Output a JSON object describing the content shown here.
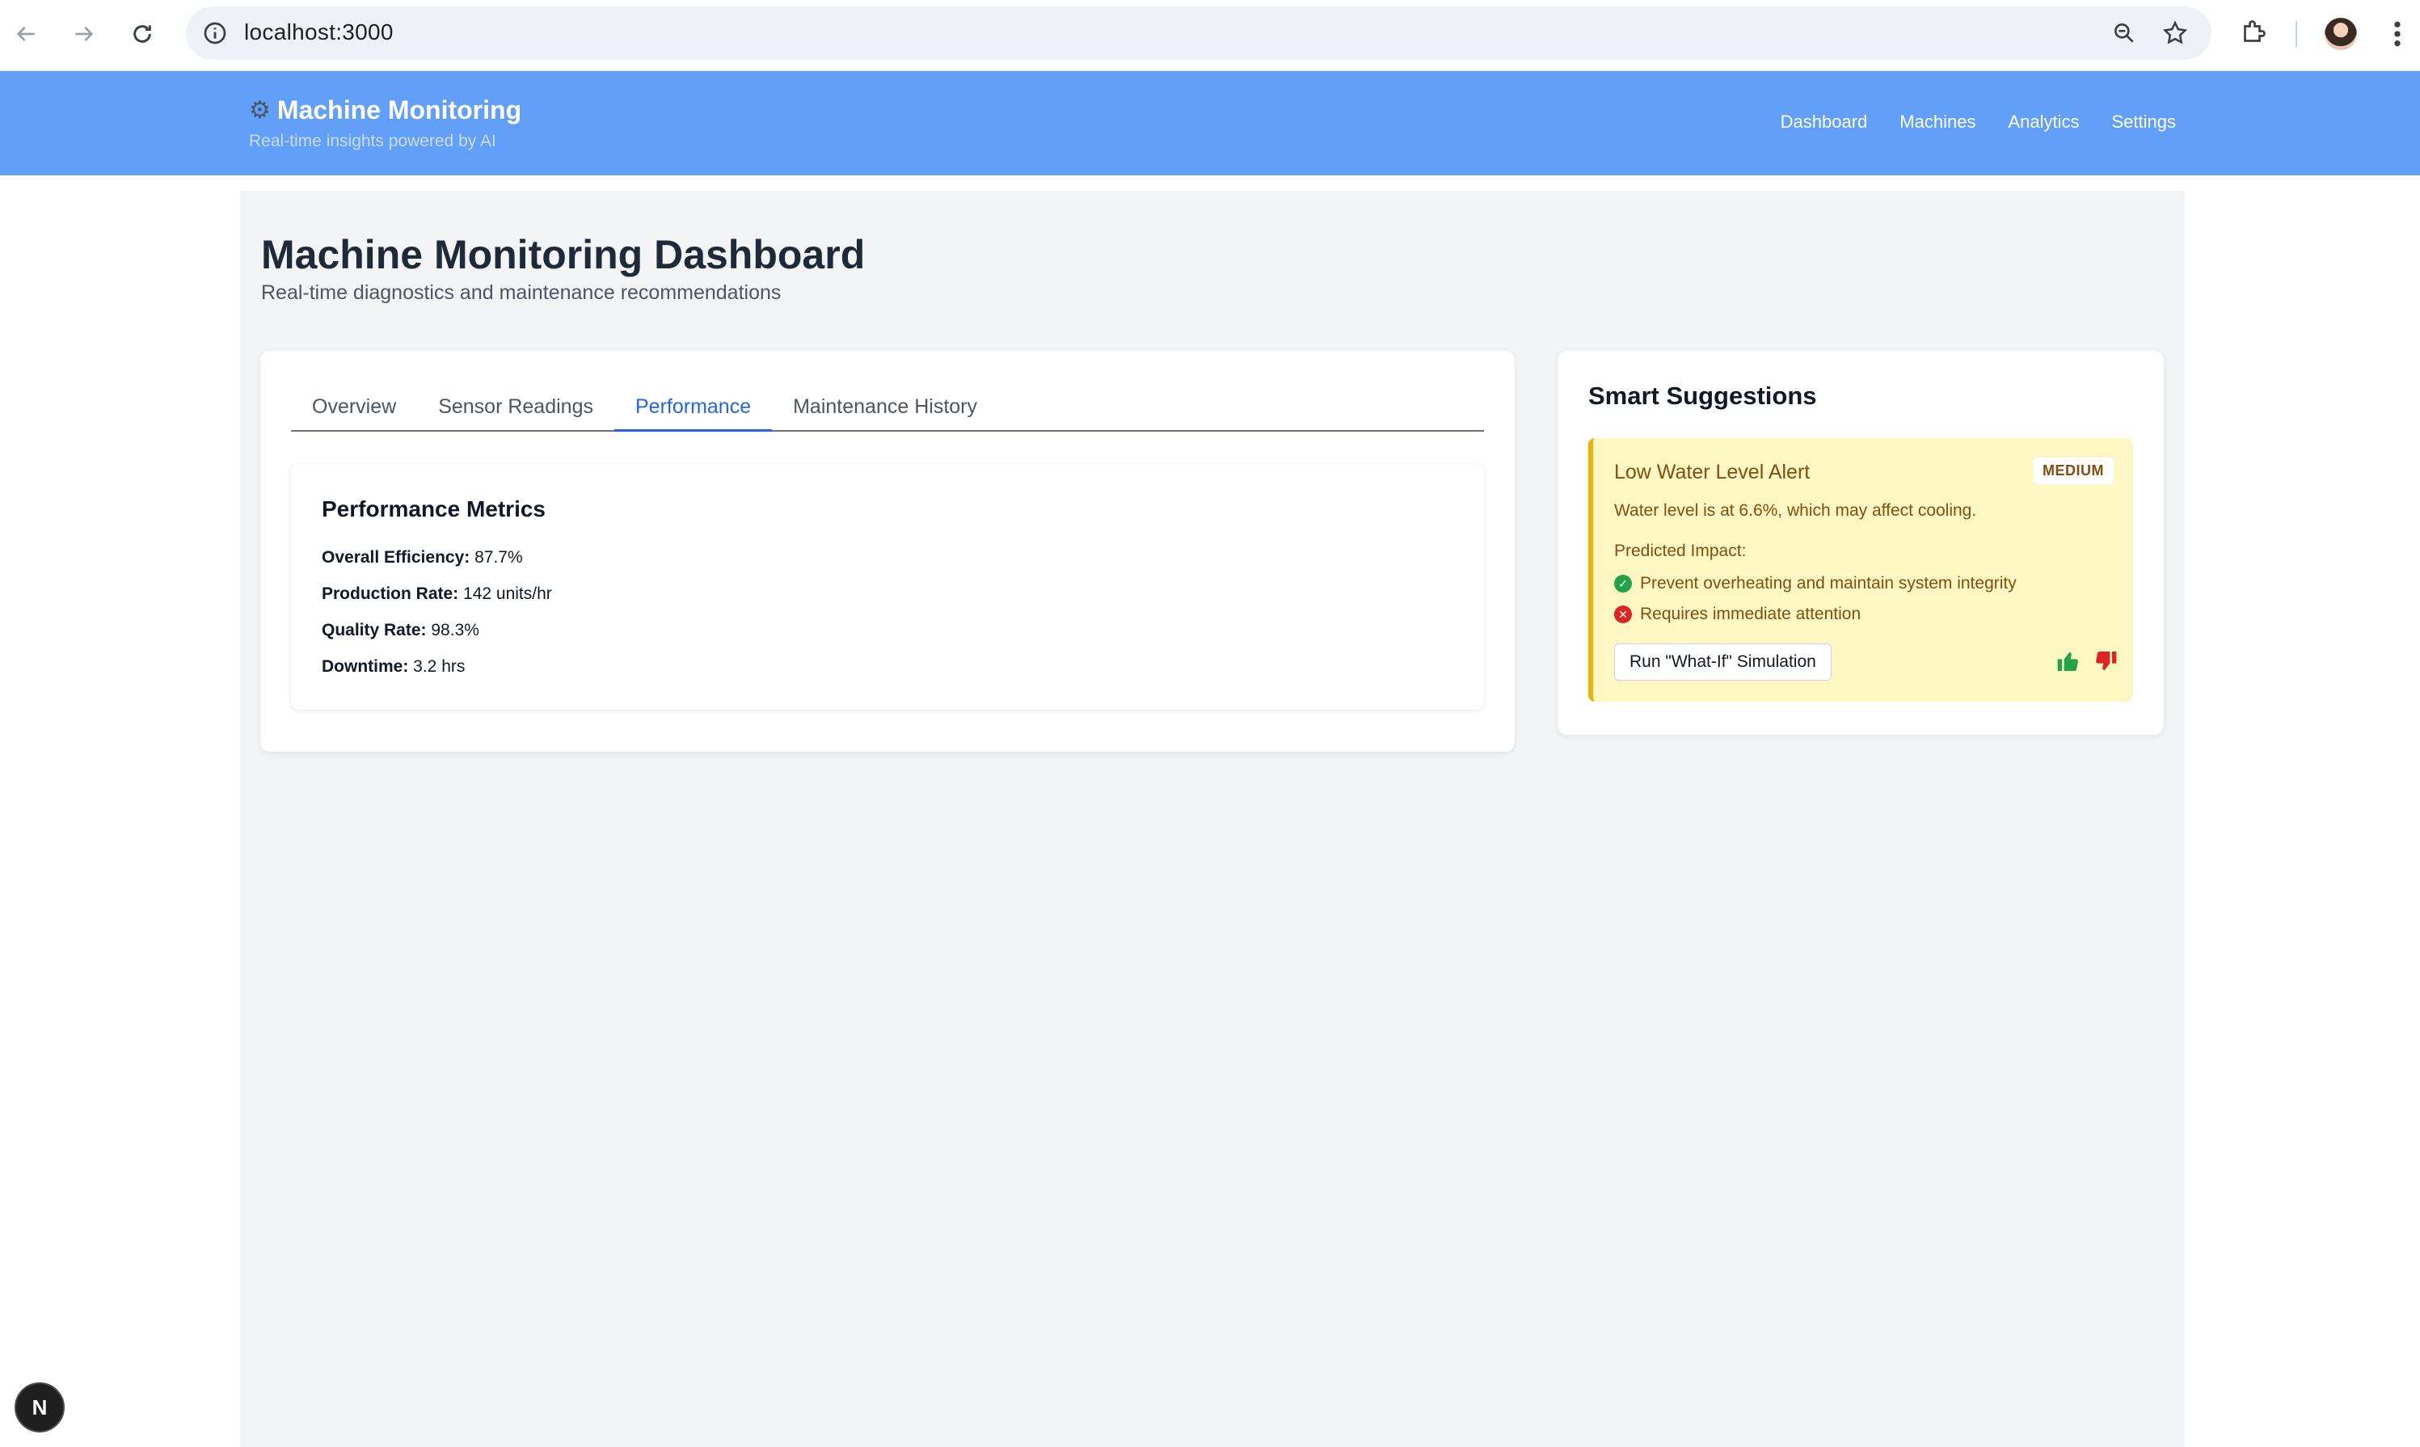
{
  "browser": {
    "url": "localhost:3000"
  },
  "header": {
    "brand_icon": "gear-icon",
    "title": "Machine Monitoring",
    "subtitle": "Real-time insights powered by AI",
    "nav": [
      "Dashboard",
      "Machines",
      "Analytics",
      "Settings"
    ]
  },
  "page": {
    "title": "Machine Monitoring Dashboard",
    "subtitle": "Real-time diagnostics and maintenance recommendations"
  },
  "tabs": {
    "items": [
      "Overview",
      "Sensor Readings",
      "Performance",
      "Maintenance History"
    ],
    "active": "Performance"
  },
  "performance": {
    "title": "Performance Metrics",
    "metrics": [
      {
        "label": "Overall Efficiency:",
        "value": "87.7%"
      },
      {
        "label": "Production Rate:",
        "value": "142 units/hr"
      },
      {
        "label": "Quality Rate:",
        "value": "98.3%"
      },
      {
        "label": "Downtime:",
        "value": "3.2 hrs"
      }
    ]
  },
  "suggestions": {
    "title": "Smart Suggestions",
    "alert": {
      "title": "Low Water Level Alert",
      "severity": "MEDIUM",
      "description": "Water level is at 6.6%, which may affect cooling.",
      "impact_label": "Predicted Impact:",
      "impacts": [
        {
          "type": "positive",
          "text": "Prevent overheating and maintain system integrity"
        },
        {
          "type": "negative",
          "text": "Requires immediate attention"
        }
      ],
      "action_label": "Run \"What-If\" Simulation"
    }
  },
  "dev_badge": "N",
  "colors": {
    "header_bg": "#629ff8",
    "accent": "#2563eb",
    "alert_bg": "#fdf7c4",
    "alert_border": "#eab308",
    "alert_text": "#854d0e",
    "positive": "#22a34a",
    "negative": "#dc2626"
  }
}
